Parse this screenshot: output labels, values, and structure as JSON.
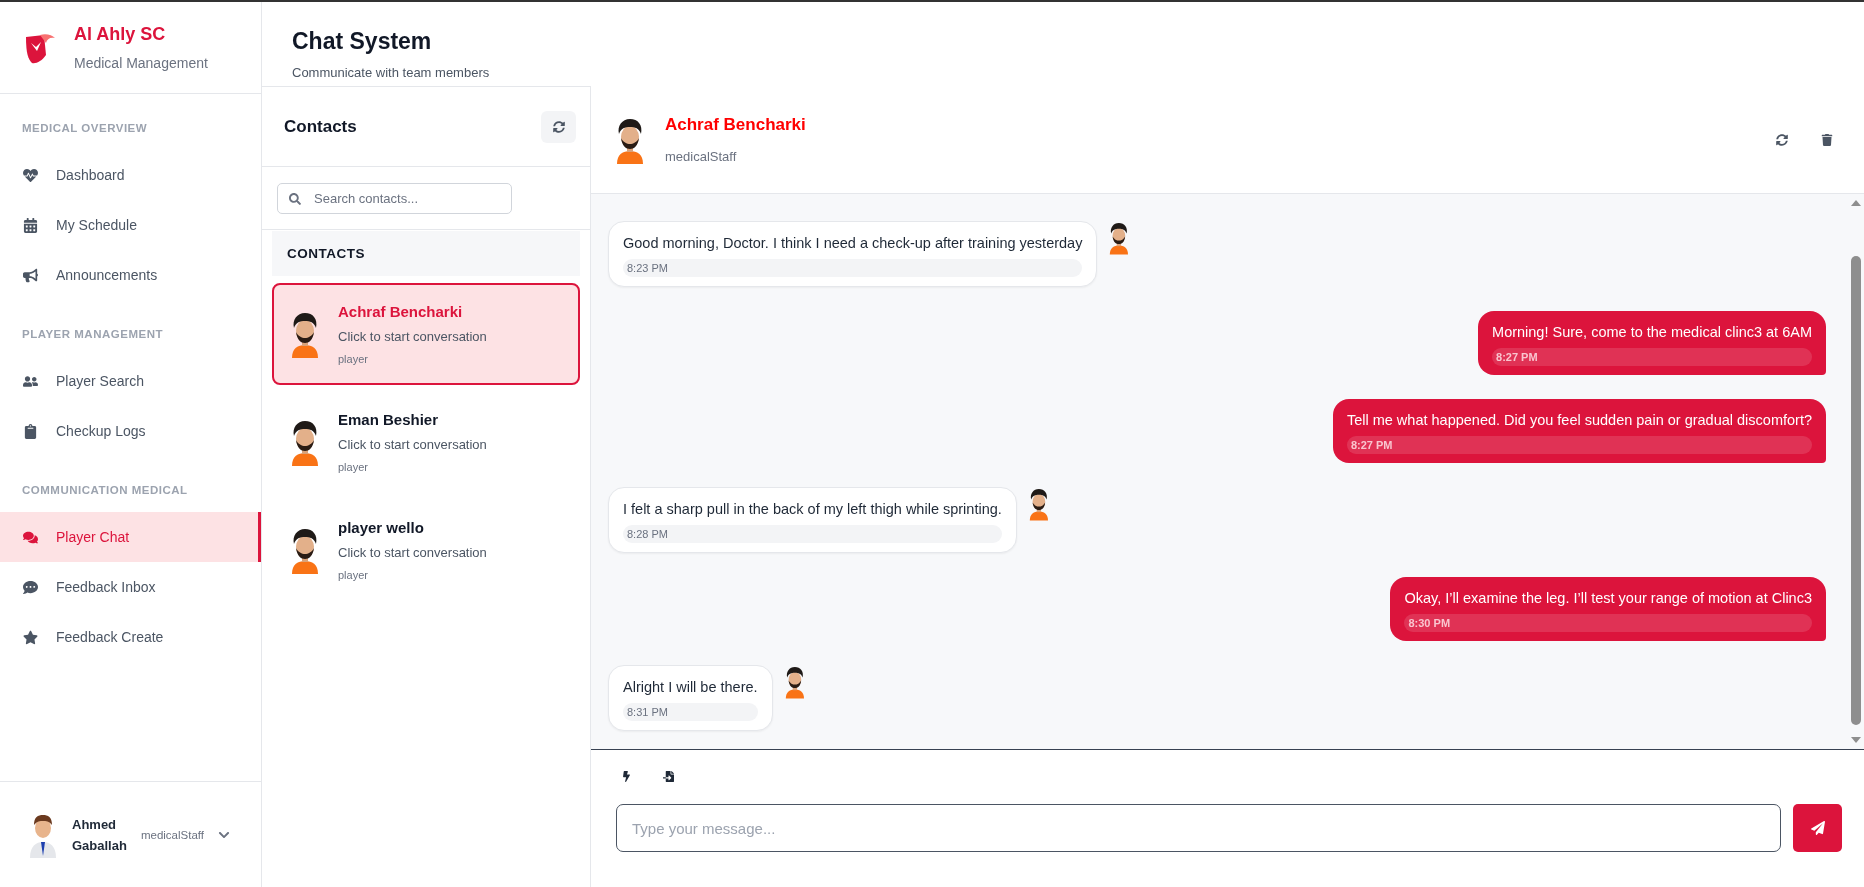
{
  "brand": {
    "name": "Al Ahly SC",
    "subtitle": "Medical Management"
  },
  "sidebar": {
    "sections": [
      {
        "title": "MEDICAL OVERVIEW",
        "items": [
          {
            "label": "Dashboard",
            "selected": false
          },
          {
            "label": "My Schedule",
            "selected": false
          },
          {
            "label": "Announcements",
            "selected": false
          }
        ]
      },
      {
        "title": "PLAYER MANAGEMENT",
        "items": [
          {
            "label": "Player Search",
            "selected": false
          },
          {
            "label": "Checkup Logs",
            "selected": false
          }
        ]
      },
      {
        "title": "COMMUNICATION MEDICAL",
        "items": [
          {
            "label": "Player Chat",
            "selected": true
          },
          {
            "label": "Feedback Inbox",
            "selected": false
          },
          {
            "label": "Feedback Create",
            "selected": false
          }
        ]
      }
    ],
    "user": {
      "first_name": "Ahmed",
      "last_name": "Gaballah",
      "role": "medicalStaff"
    }
  },
  "page": {
    "title": "Chat System",
    "subtitle": "Communicate with team members"
  },
  "contacts": {
    "title": "Contacts",
    "search": {
      "placeholder": "Search contacts..."
    },
    "section_label": "CONTACTS",
    "items": [
      {
        "name": "Achraf Bencharki",
        "preview": "Click to start conversation",
        "role": "player",
        "selected": true
      },
      {
        "name": "Eman Beshier",
        "preview": "Click to start conversation",
        "role": "player",
        "selected": false
      },
      {
        "name": "player wello",
        "preview": "Click to start conversation",
        "role": "player",
        "selected": false
      }
    ]
  },
  "chat": {
    "name": "Achraf Bencharki",
    "role": "medicalStaff",
    "messages": [
      {
        "kind": "received",
        "text": "Good morning, Doctor. I think I need a check-up after training yesterday",
        "time": "8:23 PM"
      },
      {
        "kind": "sent",
        "text": "Morning! Sure, come to the medical clinc3 at 6AM",
        "time": "8:27 PM"
      },
      {
        "kind": "sent",
        "text": "Tell me what happened. Did you feel sudden pain or gradual discomfort?",
        "time": "8:27 PM"
      },
      {
        "kind": "received",
        "text": "I felt a sharp pull in the back of my left thigh while sprinting.",
        "time": "8:28 PM"
      },
      {
        "kind": "sent",
        "text": "Okay, I’ll examine the leg. I’ll test your range of motion at Clinc3",
        "time": "8:30 PM"
      },
      {
        "kind": "received",
        "text": "Alright I will be there.",
        "time": "8:31 PM"
      }
    ],
    "input": {
      "placeholder": "Type your message..."
    }
  }
}
